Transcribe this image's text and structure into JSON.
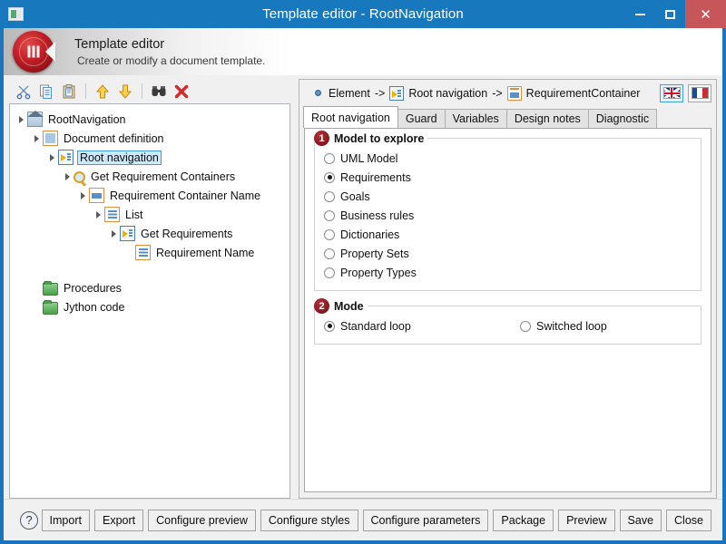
{
  "window": {
    "title": "Template editor - RootNavigation",
    "app_icon": "window-icon",
    "minimize_label": "",
    "maximize_label": "",
    "close_label": "✕"
  },
  "banner": {
    "title": "Template editor",
    "subtitle": "Create or modify a document template.",
    "logo": "pause-disc-logo"
  },
  "tree_toolbar": {
    "buttons": [
      {
        "name": "cut-button",
        "icon": "scissors-icon",
        "label": ""
      },
      {
        "name": "copy-button",
        "icon": "copy-icon",
        "label": ""
      },
      {
        "name": "paste-button",
        "icon": "paste-icon",
        "label": ""
      },
      {
        "name": "move-up-button",
        "icon": "arrow-up-icon",
        "label": ""
      },
      {
        "name": "move-down-button",
        "icon": "arrow-down-icon",
        "label": ""
      },
      {
        "name": "find-button",
        "icon": "binoculars-icon",
        "label": ""
      },
      {
        "name": "delete-button",
        "icon": "red-x-icon",
        "label": ""
      }
    ]
  },
  "tree": {
    "nodes": [
      {
        "label": "RootNavigation",
        "depth": 0,
        "icon": "house-icon",
        "expander": true,
        "selected": false
      },
      {
        "label": "Document definition",
        "depth": 1,
        "icon": "document-icon",
        "expander": true,
        "selected": false
      },
      {
        "label": "Root navigation",
        "depth": 2,
        "icon": "navigation-icon",
        "expander": true,
        "selected": true
      },
      {
        "label": "Get Requirement Containers",
        "depth": 3,
        "icon": "magnifier-icon",
        "expander": true,
        "selected": false
      },
      {
        "label": "Requirement Container Name",
        "depth": 4,
        "icon": "printer-icon",
        "expander": true,
        "selected": false
      },
      {
        "label": "List",
        "depth": 5,
        "icon": "list-icon",
        "expander": true,
        "selected": false
      },
      {
        "label": "Get Requirements",
        "depth": 6,
        "icon": "navigation-icon",
        "expander": true,
        "selected": false
      },
      {
        "label": "Requirement Name",
        "depth": 7,
        "icon": "list-icon",
        "expander": false,
        "selected": false
      },
      {
        "label": "Procedures",
        "depth": 1,
        "icon": "folder-icon",
        "expander": false,
        "selected": false,
        "spacer_before": true
      },
      {
        "label": "Jython code",
        "depth": 1,
        "icon": "folder-icon",
        "expander": false,
        "selected": false
      }
    ]
  },
  "breadcrumb": {
    "segment1": "Element",
    "arrow1": "->",
    "segment2": "Root navigation",
    "arrow2": "->",
    "segment3": "RequirementContainer"
  },
  "languages": [
    {
      "name": "flag-uk-button",
      "code": "UK",
      "active": true
    },
    {
      "name": "flag-fr-button",
      "code": "FR",
      "active": false
    }
  ],
  "tabs": [
    {
      "label": "Root navigation",
      "active": true
    },
    {
      "label": "Guard",
      "active": false
    },
    {
      "label": "Variables",
      "active": false
    },
    {
      "label": "Design notes",
      "active": false
    },
    {
      "label": "Diagnostic",
      "active": false
    }
  ],
  "groups": [
    {
      "badge": "1",
      "legend": "Model to explore",
      "layout": "column",
      "options": [
        {
          "label": "UML Model",
          "selected": false
        },
        {
          "label": "Requirements",
          "selected": true
        },
        {
          "label": "Goals",
          "selected": false
        },
        {
          "label": "Business rules",
          "selected": false
        },
        {
          "label": "Dictionaries",
          "selected": false
        },
        {
          "label": "Property Sets",
          "selected": false
        },
        {
          "label": "Property Types",
          "selected": false
        }
      ]
    },
    {
      "badge": "2",
      "legend": "Mode",
      "layout": "row",
      "options": [
        {
          "label": "Standard loop",
          "selected": true
        },
        {
          "label": "Switched loop",
          "selected": false
        }
      ]
    }
  ],
  "footer": {
    "help_glyph": "?",
    "buttons": [
      {
        "label": "Import",
        "name": "import-button"
      },
      {
        "label": "Export",
        "name": "export-button"
      },
      {
        "label": "Configure preview",
        "name": "configure-preview-button"
      },
      {
        "label": "Configure styles",
        "name": "configure-styles-button"
      },
      {
        "label": "Configure parameters",
        "name": "configure-parameters-button"
      },
      {
        "label": "Package",
        "name": "package-button"
      },
      {
        "label": "Preview",
        "name": "preview-button"
      },
      {
        "label": "Save",
        "name": "save-button"
      },
      {
        "label": "Close",
        "name": "close-button"
      }
    ]
  },
  "colors": {
    "titlebar": "#1878bd",
    "close_button": "#c7565a",
    "accent_selection": "#cde8f6",
    "badge_red": "#8d1a22",
    "logo_red": "#c21f26",
    "folder_green": "#4aa04a"
  }
}
